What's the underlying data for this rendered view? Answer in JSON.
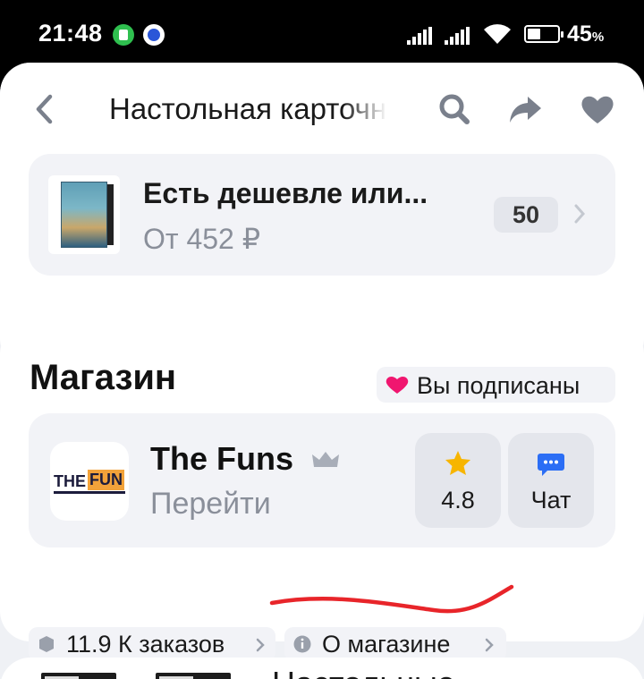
{
  "status_bar": {
    "time": "21:48",
    "battery_percent": "45",
    "battery_unit": "%",
    "battery_level": 0.45,
    "icons": [
      "app-notification-icon",
      "vpn-shield-icon",
      "signal-sim1-icon",
      "signal-sim2-icon",
      "wifi-icon",
      "battery-charging-icon"
    ]
  },
  "header": {
    "title": "Настольная карточная игра",
    "icons": [
      "back-arrow-icon",
      "search-icon",
      "share-icon",
      "heart-icon"
    ]
  },
  "offer": {
    "title": "Есть дешевле или...",
    "price": "От 452 ₽",
    "count": "50"
  },
  "shop": {
    "section_title": "Магазин",
    "subscribed_label": "Вы подписаны",
    "store_name": "The Funs",
    "store_link": "Перейти",
    "logo_text_1": "THE",
    "logo_text_2": "FUN",
    "rating": "4.8",
    "chat_label": "Чат",
    "orders_label": "11.9 К заказов",
    "about_label": "О магазине"
  },
  "next_card": {
    "title": "Настольные"
  },
  "colors": {
    "accent_red": "#e8252a",
    "pink_heart": "#f0166f",
    "star_yellow": "#f7b500",
    "chat_blue": "#2b6ef5",
    "icon_gray": "#9aa0ab"
  }
}
